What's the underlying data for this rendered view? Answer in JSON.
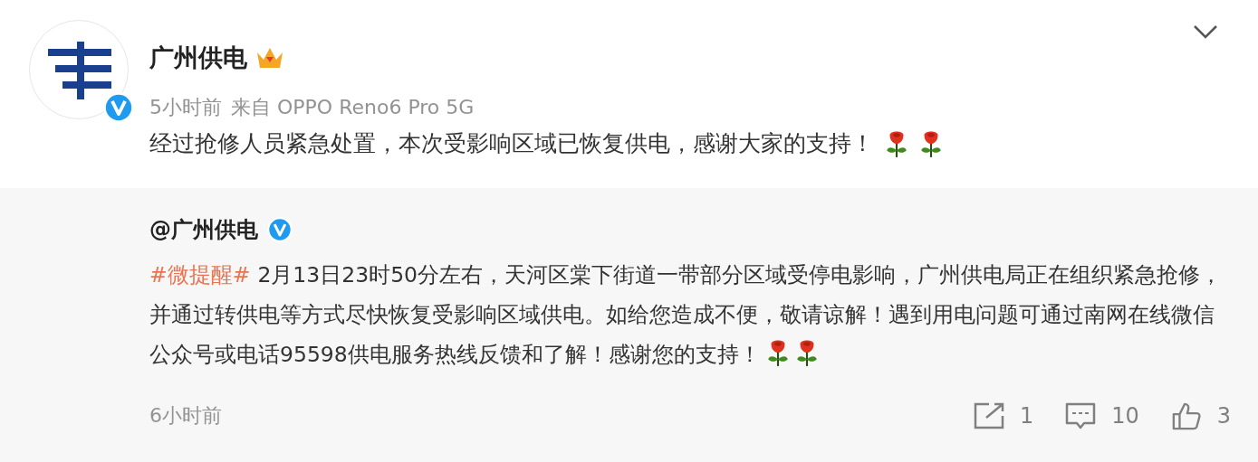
{
  "post": {
    "author": "广州供电",
    "verified": true,
    "time": "5小时前",
    "source": "来自 OPPO Reno6 Pro 5G",
    "text": "经过抢修人员紧急处置，本次受影响区域已恢复供电，感谢大家的支持！",
    "emoji": [
      {
        "kind": "rose"
      },
      {
        "kind": "rose"
      }
    ]
  },
  "repost": {
    "author": "@广州供电",
    "verified": true,
    "topic": "#微提醒#",
    "text": "2月13日23时50分左右，天河区棠下街道一带部分区域受停电影响，广州供电局正在组织紧急抢修，并通过转供电等方式尽快恢复受影响区域供电。如给您造成不便，敬请谅解！遇到用电问题可通过南网在线微信公众号或电话95598供电服务热线反馈和了解！感谢您的支持！",
    "emoji": [
      {
        "kind": "rose"
      },
      {
        "kind": "rose"
      }
    ],
    "time": "6小时前",
    "actions": [
      {
        "kind": "share",
        "count": "1"
      },
      {
        "kind": "comment",
        "count": "10"
      },
      {
        "kind": "like",
        "count": "3"
      }
    ]
  }
}
